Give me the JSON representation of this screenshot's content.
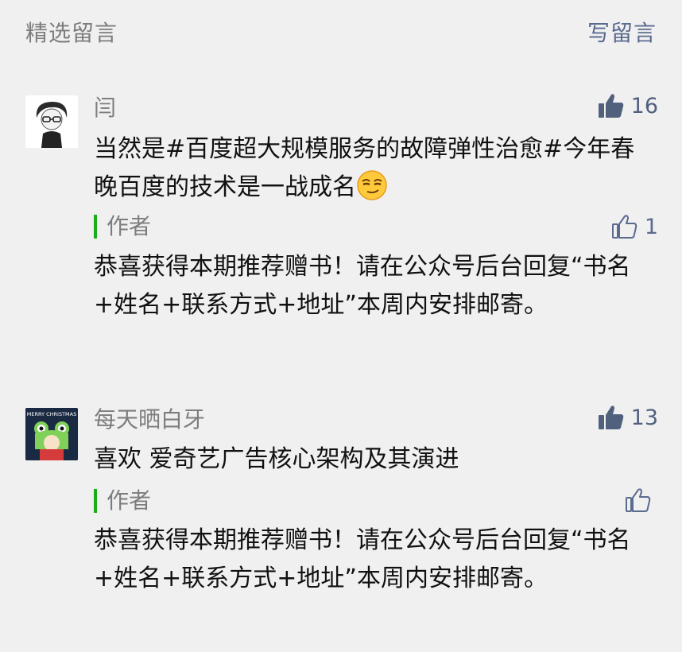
{
  "header": {
    "title": "精选留言",
    "write_label": "写留言"
  },
  "comments": [
    {
      "nickname": "闫",
      "likes": "16",
      "content": "当然是#百度超大规模服务的故障弹性治愈#今年春晚百度的技术是一战成名",
      "emoji": "smirk-emoji",
      "reply": {
        "label": "作者",
        "likes": "1",
        "content": "恭喜获得本期推荐赠书！请在公众号后台回复“书名+姓名+联系方式+地址”本周内安排邮寄。"
      }
    },
    {
      "nickname": "每天晒白牙",
      "likes": "13",
      "avatar_text": "MERRY CHRISTMAS",
      "content": "喜欢 爱奇艺广告核心架构及其演进",
      "reply": {
        "label": "作者",
        "likes": "",
        "content": "恭喜获得本期推荐赠书！请在公众号后台回复“书名+姓名+联系方式+地址”本周内安排邮寄。"
      }
    }
  ],
  "colors": {
    "accent_green": "#1aad19",
    "link_blue": "#5b6b8f",
    "like_fill": "#50607d",
    "background": "#f0f0f1"
  }
}
